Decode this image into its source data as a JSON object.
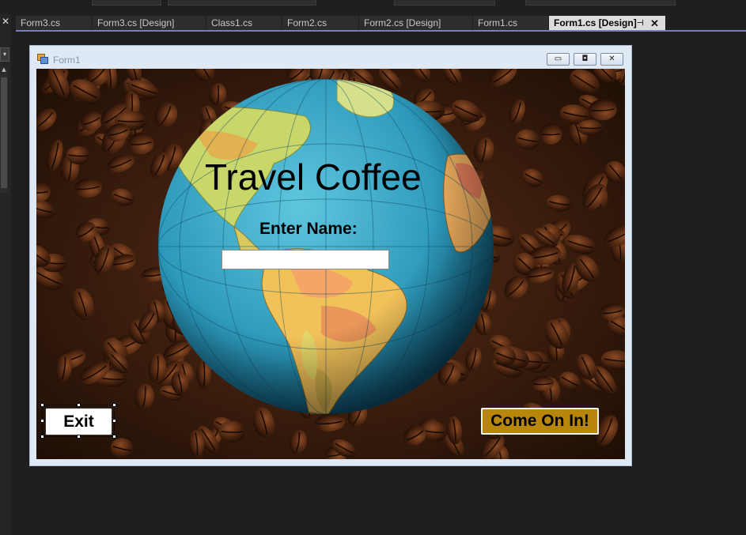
{
  "ide": {
    "tabs": [
      {
        "label": "Form3.cs",
        "active": false
      },
      {
        "label": "Form3.cs [Design]",
        "active": false
      },
      {
        "label": "Class1.cs",
        "active": false
      },
      {
        "label": "Form2.cs",
        "active": false
      },
      {
        "label": "Form2.cs [Design]",
        "active": false
      },
      {
        "label": "Form1.cs",
        "active": false
      },
      {
        "label": "Form1.cs [Design]",
        "active": true
      }
    ],
    "accent_color": "#7b76d8"
  },
  "form": {
    "title": "Form1",
    "heading": "Travel Coffee",
    "name_label": "Enter Name:",
    "name_input_value": "",
    "exit_label": "Exit",
    "enter_label": "Come On In!",
    "enter_button_color": "#b8860b"
  },
  "icons": {
    "form_icon": "form-icon",
    "minimize": "minimize-icon",
    "maximize": "maximize-icon",
    "close": "close-icon",
    "pin": "pin-icon"
  }
}
